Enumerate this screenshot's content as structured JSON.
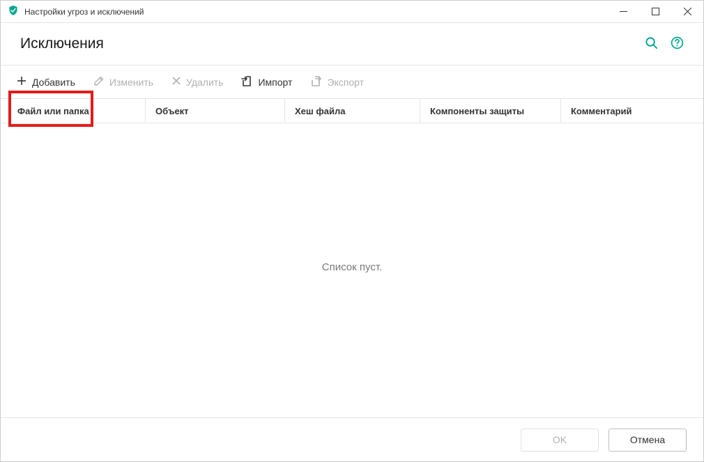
{
  "window": {
    "title": "Настройки угроз и исключений"
  },
  "header": {
    "title": "Исключения"
  },
  "toolbar": {
    "add": "Добавить",
    "edit": "Изменить",
    "delete": "Удалить",
    "import": "Импорт",
    "export": "Экспорт"
  },
  "columns": {
    "c1": "Файл или папка",
    "c2": "Объект",
    "c3": "Хеш файла",
    "c4": "Компоненты защиты",
    "c5": "Комментарий"
  },
  "empty": "Список пуст.",
  "footer": {
    "ok": "OK",
    "cancel": "Отмена"
  }
}
